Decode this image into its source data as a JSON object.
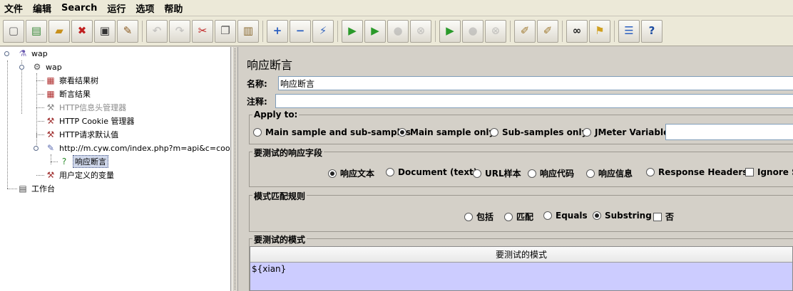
{
  "menubar": {
    "items": [
      "文件",
      "编辑",
      "Search",
      "运行",
      "选项",
      "帮助"
    ]
  },
  "toolbar": {
    "buttons": [
      {
        "name": "new-icon",
        "glyph": "▢",
        "color": "#666666"
      },
      {
        "name": "templates-icon",
        "glyph": "▤",
        "color": "#3a8a3a"
      },
      {
        "name": "open-icon",
        "glyph": "▰",
        "color": "#c8901a"
      },
      {
        "name": "close-icon",
        "glyph": "✖",
        "color": "#c02020"
      },
      {
        "name": "save-icon",
        "glyph": "▣",
        "color": "#333333"
      },
      {
        "name": "save-as-icon",
        "glyph": "✎",
        "color": "#8a5a20"
      },
      {
        "name": "undo-icon",
        "glyph": "↶",
        "color": "#999999"
      },
      {
        "name": "redo-icon",
        "glyph": "↷",
        "color": "#999999"
      },
      {
        "name": "cut-icon",
        "glyph": "✂",
        "color": "#c02020"
      },
      {
        "name": "copy-icon",
        "glyph": "❐",
        "color": "#555555"
      },
      {
        "name": "paste-icon",
        "glyph": "▥",
        "color": "#8a6a30"
      },
      {
        "name": "expand-icon",
        "glyph": "+",
        "color": "#2a5fc0"
      },
      {
        "name": "collapse-icon",
        "glyph": "−",
        "color": "#2a5fc0"
      },
      {
        "name": "toggle-icon",
        "glyph": "⚡",
        "color": "#3a6ac0"
      },
      {
        "name": "start-icon",
        "glyph": "▶",
        "color": "#2a9a2a"
      },
      {
        "name": "start-no-pause-icon",
        "glyph": "▶",
        "color": "#2a9a2a"
      },
      {
        "name": "stop-icon",
        "glyph": "●",
        "color": "#9a9a9a"
      },
      {
        "name": "shutdown-icon",
        "glyph": "⊗",
        "color": "#9a9a9a"
      },
      {
        "name": "remote-start-icon",
        "glyph": "▶",
        "color": "#2a9a2a"
      },
      {
        "name": "remote-stop-icon",
        "glyph": "●",
        "color": "#9a9a9a"
      },
      {
        "name": "remote-shutdown-icon",
        "glyph": "⊗",
        "color": "#9a9a9a"
      },
      {
        "name": "clear-icon",
        "glyph": "✐",
        "color": "#a07a30"
      },
      {
        "name": "clear-all-icon",
        "glyph": "✐",
        "color": "#a07a30"
      },
      {
        "name": "search-icon",
        "glyph": "∞",
        "color": "#222222"
      },
      {
        "name": "reset-search-icon",
        "glyph": "⚑",
        "color": "#d0a020"
      },
      {
        "name": "function-helper-icon",
        "glyph": "☰",
        "color": "#2a5fc0"
      },
      {
        "name": "help-icon",
        "glyph": "?",
        "color": "#1a4aa0"
      }
    ]
  },
  "tree": {
    "nodes": [
      {
        "label": "wap",
        "icon": "⚗",
        "icon_color": "#6a5ab0"
      },
      {
        "label": "wap",
        "icon": "⚙",
        "icon_color": "#555555"
      },
      {
        "label": "察看结果树",
        "icon": "▦",
        "icon_color": "#b03030"
      },
      {
        "label": "断言结果",
        "icon": "▦",
        "icon_color": "#b03030"
      },
      {
        "label": "HTTP信息头管理器",
        "icon": "⚒",
        "icon_color": "#888888"
      },
      {
        "label": "HTTP Cookie 管理器",
        "icon": "⚒",
        "icon_color": "#a03030"
      },
      {
        "label": "HTTP请求默认值",
        "icon": "⚒",
        "icon_color": "#a03030"
      },
      {
        "label": "http://m.cyw.com/index.php?m=api&c=cookie&a=s",
        "icon": "✎",
        "icon_color": "#5a6ab0"
      },
      {
        "label": "响应断言",
        "icon": "?",
        "icon_color": "#2a8a2a"
      },
      {
        "label": "用户定义的变量",
        "icon": "⚒",
        "icon_color": "#a03030"
      },
      {
        "label": "工作台",
        "icon": "▤",
        "icon_color": "#444444"
      }
    ]
  },
  "panel": {
    "title": "响应断言",
    "name_label": "名称:",
    "name_value": "响应断言",
    "comment_label": "注释:",
    "comment_value": "",
    "apply_to": {
      "title": "Apply to:",
      "options": [
        "Main sample and sub-samples",
        "Main sample only",
        "Sub-samples only",
        "JMeter Variable"
      ],
      "selected": "Main sample only",
      "variable_value": ""
    },
    "field_to_test": {
      "title": "要测试的响应字段",
      "options": [
        "响应文本",
        "Document (text)",
        "URL样本",
        "响应代码",
        "响应信息",
        "Response Headers"
      ],
      "selected": "响应文本",
      "ignore_status_label": "Ignore St",
      "ignore_status_checked": false
    },
    "matching_rules": {
      "title": "模式匹配规则",
      "options": [
        "包括",
        "匹配",
        "Equals",
        "Substring"
      ],
      "selected": "Substring",
      "not_label": "否",
      "not_checked": false
    },
    "patterns": {
      "title": "要测试的模式",
      "column_header": "要测试的模式",
      "rows": [
        "${xian}"
      ]
    }
  },
  "colors": {
    "window_bg": "#d4d0c8",
    "pattern_row_bg": "#ccccff",
    "selection_bg": "#cfd7ea"
  }
}
